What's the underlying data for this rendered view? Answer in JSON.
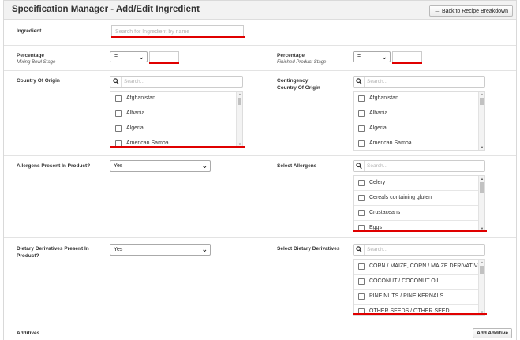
{
  "header": {
    "title": "Specification Manager - Add/Edit Ingredient",
    "back_button": "Back to Recipe Breakdown",
    "back_icon": "left-arrow-icon"
  },
  "ingredient": {
    "label": "Ingredient",
    "placeholder": "Search for Ingredient by name",
    "value": ""
  },
  "percentage_mixing": {
    "label": "Percentage",
    "sublabel": "Mixing Bowl Stage",
    "operator": "=",
    "value": ""
  },
  "percentage_finished": {
    "label": "Percentage",
    "sublabel": "Finished Product Stage",
    "operator": "=",
    "value": ""
  },
  "country_of_origin": {
    "label": "Country Of Origin",
    "search_placeholder": "Search...",
    "items": [
      "Afghanistan",
      "Albania",
      "Algeria",
      "American Samoa"
    ]
  },
  "contingency_country": {
    "label_line1": "Contingency",
    "label_line2": "Country Of Origin",
    "search_placeholder": "Search...",
    "items": [
      "Afghanistan",
      "Albania",
      "Algeria",
      "American Samoa"
    ]
  },
  "allergens_present": {
    "label": "Allergens Present In Product?",
    "selected": "Yes"
  },
  "select_allergens": {
    "label": "Select Allergens",
    "search_placeholder": "Search...",
    "items": [
      "Celery",
      "Cereals containing gluten",
      "Crustaceans",
      "Eggs"
    ]
  },
  "dietary_present": {
    "label_line1": "Dietary Derivatives Present In",
    "label_line2": "Product?",
    "selected": "Yes"
  },
  "select_dietary": {
    "label": "Select Dietary Derivatives",
    "search_placeholder": "Search...",
    "items": [
      "CORN / MAIZE, CORN / MAIZE DERIVATIVES",
      "COCONUT / COCONUT OIL",
      "PINE NUTS / PINE KERNALS",
      "OTHER SEEDS / OTHER SEED"
    ]
  },
  "additives": {
    "label": "Additives",
    "add_button": "Add Additive"
  },
  "colors": {
    "annotation_red": "#e00000",
    "header_bg": "#f2f2f2"
  }
}
